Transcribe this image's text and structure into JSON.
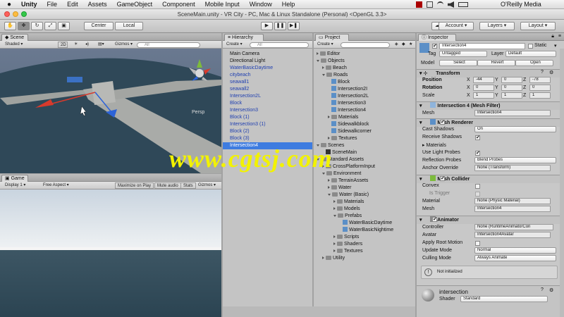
{
  "menubar": {
    "apple": "",
    "app": "Unity",
    "items": [
      "File",
      "Edit",
      "Assets",
      "GameObject",
      "Component",
      "Mobile Input",
      "Window",
      "Help"
    ],
    "publisher": "O'Reilly Media"
  },
  "window": {
    "title": "SceneMain.unity - VR City - PC, Mac & Linux Standalone (Personal) <OpenGL 3.3>"
  },
  "toolbar": {
    "center": "Center",
    "local": "Local",
    "account": "Account",
    "layers": "Layers",
    "layout": "Layout"
  },
  "scene": {
    "tab": "Scene",
    "shading": "Shaded",
    "mode2d": "2D",
    "gizmos": "Gizmos",
    "search_placeholder": "All",
    "persp": "Persp"
  },
  "game": {
    "tab": "Game",
    "display": "Display 1",
    "aspect": "Free Aspect",
    "maximize": "Maximize on Play",
    "mute": "Mute audio",
    "stats": "Stats",
    "gizmos": "Gizmos"
  },
  "hierarchy": {
    "tab": "Hierarchy",
    "create": "Create",
    "search_placeholder": "All",
    "items": [
      {
        "label": "Main Camera",
        "blue": false
      },
      {
        "label": "Directional Light",
        "blue": false
      },
      {
        "label": "WaterBasicDaytime",
        "blue": true
      },
      {
        "label": "citybeach",
        "blue": true
      },
      {
        "label": "seawall1",
        "blue": true
      },
      {
        "label": "seawall2",
        "blue": true
      },
      {
        "label": "Intersection2L",
        "blue": true
      },
      {
        "label": "Block",
        "blue": true
      },
      {
        "label": "Intersection3",
        "blue": true
      },
      {
        "label": "Block (1)",
        "blue": true
      },
      {
        "label": "Intersection3 (1)",
        "blue": true
      },
      {
        "label": "Block (2)",
        "blue": true
      },
      {
        "label": "Block (3)",
        "blue": true
      },
      {
        "label": "Intersection4",
        "blue": true,
        "selected": true
      }
    ]
  },
  "project": {
    "tab": "Project",
    "create": "Create",
    "items": [
      {
        "label": "Editor",
        "depth": 0,
        "type": "folder",
        "open": false
      },
      {
        "label": "Objects",
        "depth": 0,
        "type": "folder",
        "open": true
      },
      {
        "label": "Beach",
        "depth": 1,
        "type": "folder",
        "open": false
      },
      {
        "label": "Roads",
        "depth": 1,
        "type": "folder",
        "open": true
      },
      {
        "label": "Block",
        "depth": 2,
        "type": "asset",
        "open": false
      },
      {
        "label": "Intersection2I",
        "depth": 2,
        "type": "asset",
        "open": false
      },
      {
        "label": "Intersection2L",
        "depth": 2,
        "type": "asset",
        "open": false
      },
      {
        "label": "Intersection3",
        "depth": 2,
        "type": "asset",
        "open": false
      },
      {
        "label": "Intersection4",
        "depth": 2,
        "type": "asset",
        "open": false
      },
      {
        "label": "Materials",
        "depth": 2,
        "type": "folder",
        "open": false
      },
      {
        "label": "Sidewalkblock",
        "depth": 2,
        "type": "asset",
        "open": false
      },
      {
        "label": "Sidewalkcorner",
        "depth": 2,
        "type": "asset",
        "open": false
      },
      {
        "label": "Textures",
        "depth": 2,
        "type": "folder",
        "open": false
      },
      {
        "label": "Scenes",
        "depth": 0,
        "type": "folder",
        "open": true
      },
      {
        "label": "SceneMain",
        "depth": 1,
        "type": "scene",
        "open": false
      },
      {
        "label": "Standard Assets",
        "depth": 0,
        "type": "folder",
        "open": true
      },
      {
        "label": "CrossPlatformInput",
        "depth": 1,
        "type": "folder",
        "open": false
      },
      {
        "label": "Environment",
        "depth": 1,
        "type": "folder",
        "open": true
      },
      {
        "label": "TerrainAssets",
        "depth": 2,
        "type": "folder",
        "open": false
      },
      {
        "label": "Water",
        "depth": 2,
        "type": "folder",
        "open": false
      },
      {
        "label": "Water (Basic)",
        "depth": 2,
        "type": "folder",
        "open": true
      },
      {
        "label": "Materials",
        "depth": 3,
        "type": "folder",
        "open": false
      },
      {
        "label": "Models",
        "depth": 3,
        "type": "folder",
        "open": false
      },
      {
        "label": "Prefabs",
        "depth": 3,
        "type": "folder",
        "open": true
      },
      {
        "label": "WaterBasicDaytime",
        "depth": 4,
        "type": "asset",
        "open": false
      },
      {
        "label": "WaterBasicNightime",
        "depth": 4,
        "type": "asset",
        "open": false
      },
      {
        "label": "Scripts",
        "depth": 3,
        "type": "folder",
        "open": false
      },
      {
        "label": "Shaders",
        "depth": 3,
        "type": "folder",
        "open": false
      },
      {
        "label": "Textures",
        "depth": 3,
        "type": "folder",
        "open": false
      },
      {
        "label": "Utility",
        "depth": 1,
        "type": "folder",
        "open": false
      }
    ]
  },
  "inspector": {
    "tab": "Inspector",
    "object_name": "Intersection4",
    "static": "Static",
    "tag_label": "Tag",
    "tag_value": "Untagged",
    "layer_label": "Layer",
    "layer_value": "Default",
    "model_label": "Model",
    "model_buttons": [
      "Select",
      "Revert",
      "Open"
    ],
    "transform": {
      "title": "Transform",
      "position_label": "Position",
      "rotation_label": "Rotation",
      "scale_label": "Scale",
      "position": {
        "x": "-44",
        "y": "0",
        "z": "-78"
      },
      "rotation": {
        "x": "0",
        "y": "0",
        "z": "0"
      },
      "scale": {
        "x": "1",
        "y": "1",
        "z": "1"
      }
    },
    "mesh_filter": {
      "title": "Intersection 4 (Mesh Filter)",
      "mesh_label": "Mesh",
      "mesh_value": "Intersection4"
    },
    "mesh_renderer": {
      "title": "Mesh Renderer",
      "cast_shadows_label": "Cast Shadows",
      "cast_shadows": "On",
      "receive_shadows_label": "Receive Shadows",
      "materials_label": "Materials",
      "light_probes_label": "Use Light Probes",
      "reflection_probes_label": "Reflection Probes",
      "reflection_probes": "Blend Probes",
      "anchor_label": "Anchor Override",
      "anchor_value": "None (Transform)"
    },
    "mesh_collider": {
      "title": "Mesh Collider",
      "convex_label": "Convex",
      "trigger_label": "Is Trigger",
      "material_label": "Material",
      "material_value": "None (Physic Material)",
      "mesh_label": "Mesh",
      "mesh_value": "Intersection4"
    },
    "animator": {
      "title": "Animator",
      "controller_label": "Controller",
      "controller_value": "None (RuntimeAnimatorCon",
      "avatar_label": "Avatar",
      "avatar_value": "Intersection4Avatar",
      "root_motion_label": "Apply Root Motion",
      "update_label": "Update Mode",
      "update_value": "Normal",
      "culling_label": "Culling Mode",
      "culling_value": "Always Animate",
      "info": "Not initialized"
    },
    "material": {
      "name": "intersection",
      "shader_label": "Shader",
      "shader_value": "Standard"
    }
  },
  "watermark": "www.cgtsj.com",
  "colors": {
    "selection": "#3e7ce0",
    "sky": "#5e6f86",
    "water": "#2f4858",
    "road": "#a9aba8"
  }
}
